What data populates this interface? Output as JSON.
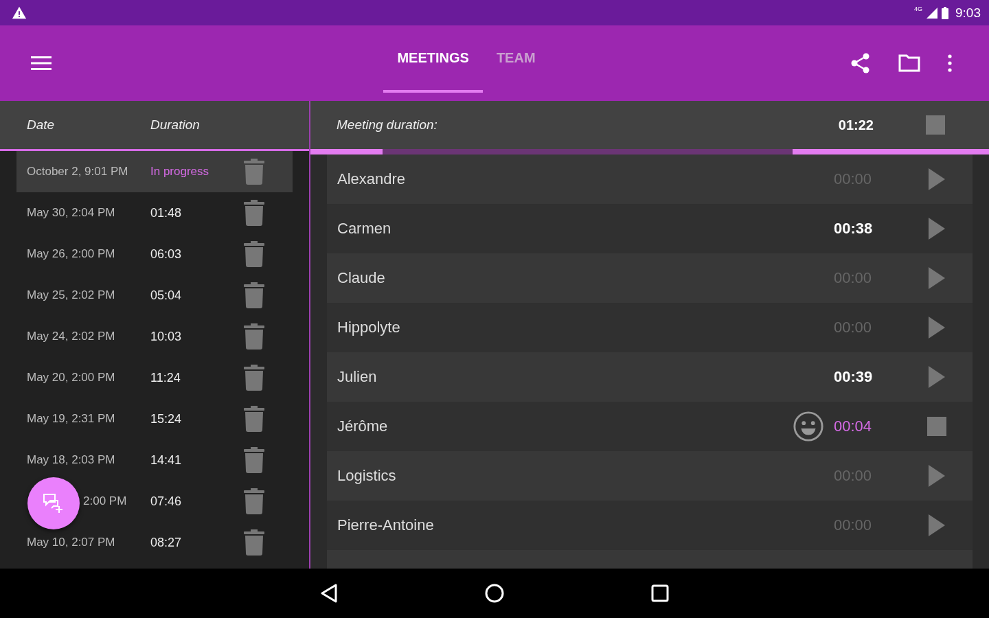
{
  "status_bar": {
    "time": "9:03",
    "network": "4G"
  },
  "toolbar": {
    "tabs": [
      {
        "label": "MEETINGS",
        "selected": true
      },
      {
        "label": "TEAM",
        "selected": false
      }
    ]
  },
  "meetings": {
    "columns": [
      "Date",
      "Duration"
    ],
    "rows": [
      {
        "date": "October 2, 9:01 PM",
        "duration": "In progress",
        "kind": "progress",
        "selected": true
      },
      {
        "date": "May 30, 2:04 PM",
        "duration": "01:48",
        "kind": "done",
        "selected": false
      },
      {
        "date": "May 26, 2:00 PM",
        "duration": "06:03",
        "kind": "done",
        "selected": false
      },
      {
        "date": "May 25, 2:02 PM",
        "duration": "05:04",
        "kind": "done",
        "selected": false
      },
      {
        "date": "May 24, 2:02 PM",
        "duration": "10:03",
        "kind": "done",
        "selected": false
      },
      {
        "date": "May 20, 2:00 PM",
        "duration": "11:24",
        "kind": "done",
        "selected": false
      },
      {
        "date": "May 19, 2:31 PM",
        "duration": "15:24",
        "kind": "done",
        "selected": false
      },
      {
        "date": "May 18, 2:03 PM",
        "duration": "14:41",
        "kind": "done",
        "selected": false
      },
      {
        "date": "2:00 PM",
        "duration": "07:46",
        "kind": "done",
        "selected": false
      },
      {
        "date": "May 10, 2:07 PM",
        "duration": "08:27",
        "kind": "done",
        "selected": false
      }
    ]
  },
  "meeting": {
    "label": "Meeting duration:",
    "duration": "01:22",
    "running": true,
    "participants": [
      {
        "name": "Alexandre",
        "time": "00:00",
        "kind": "idle"
      },
      {
        "name": "Carmen",
        "time": "00:38",
        "kind": "spoke"
      },
      {
        "name": "Claude",
        "time": "00:00",
        "kind": "idle"
      },
      {
        "name": "Hippolyte",
        "time": "00:00",
        "kind": "idle"
      },
      {
        "name": "Julien",
        "time": "00:39",
        "kind": "spoke"
      },
      {
        "name": "Jérôme",
        "time": "00:04",
        "kind": "speaking"
      },
      {
        "name": "Logistics",
        "time": "00:00",
        "kind": "idle"
      },
      {
        "name": "Pierre-Antoine",
        "time": "00:00",
        "kind": "idle"
      }
    ]
  }
}
